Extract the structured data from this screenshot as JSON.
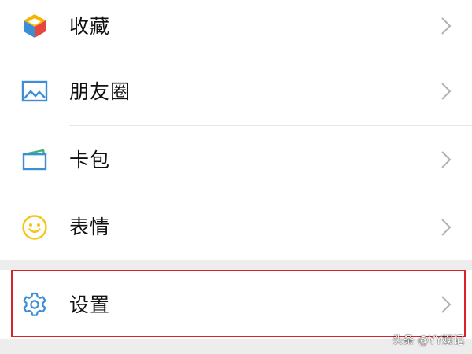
{
  "menu": {
    "items": [
      {
        "label": "收藏",
        "icon": "favorites-cube-icon"
      },
      {
        "label": "朋友圈",
        "icon": "moments-photo-icon"
      },
      {
        "label": "卡包",
        "icon": "card-wallet-icon"
      },
      {
        "label": "表情",
        "icon": "sticker-smiley-icon"
      }
    ],
    "settings": {
      "label": "设置",
      "icon": "gear-icon"
    }
  },
  "watermark": {
    "text": "头条 @YY娱记"
  },
  "colors": {
    "background": "#ededed",
    "row": "#ffffff",
    "label": "#111111",
    "chevron": "#b2b2b2",
    "highlight": "#d9232a",
    "icon_blue": "#3c8fd6",
    "icon_green": "#3cb371",
    "icon_yellow": "#f5c518"
  }
}
